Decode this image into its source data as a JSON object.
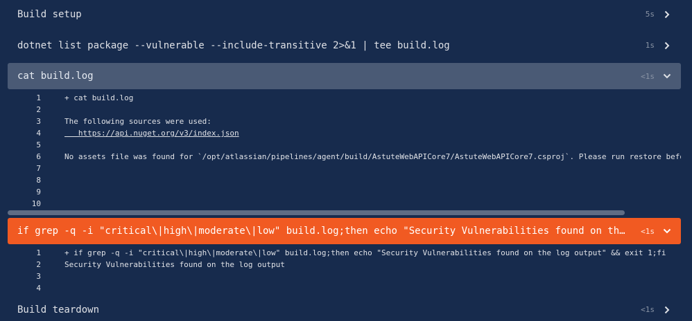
{
  "steps": [
    {
      "title": "Build setup",
      "duration": "5s",
      "chevron": "chevron-right-icon"
    },
    {
      "title": "dotnet list package --vulnerable --include-transitive 2>&1 | tee build.log",
      "duration": "1s",
      "chevron": "chevron-right-icon"
    },
    {
      "title": "cat build.log",
      "duration": "<1s",
      "chevron": "chevron-down-icon"
    },
    {
      "title": "if grep -q -i \"critical\\|high\\|moderate\\|low\" build.log;then echo \"Security Vulnerabilities found on the log output\"…",
      "duration": "<1s",
      "chevron": "chevron-down-icon"
    },
    {
      "title": "Build teardown",
      "duration": "<1s",
      "chevron": "chevron-right-icon"
    }
  ],
  "log_cat": [
    {
      "n": "1",
      "text": "+ cat build.log"
    },
    {
      "n": "2",
      "text": ""
    },
    {
      "n": "3",
      "text": "The following sources were used:"
    },
    {
      "n": "4",
      "text": "   https://api.nuget.org/v3/index.json"
    },
    {
      "n": "5",
      "text": ""
    },
    {
      "n": "6",
      "text": "No assets file was found for `/opt/atlassian/pipelines/agent/build/AstuteWebAPICore7/AstuteWebAPICore7.csproj`. Please run restore before running"
    },
    {
      "n": "7",
      "text": ""
    },
    {
      "n": "8",
      "text": ""
    },
    {
      "n": "9",
      "text": ""
    },
    {
      "n": "10",
      "text": ""
    }
  ],
  "log_grep": [
    {
      "n": "1",
      "text": "+ if grep -q -i \"critical\\|high\\|moderate\\|low\" build.log;then echo \"Security Vulnerabilities found on the log output\" && exit 1;fi"
    },
    {
      "n": "2",
      "text": "Security Vulnerabilities found on the log output"
    },
    {
      "n": "3",
      "text": ""
    },
    {
      "n": "4",
      "text": ""
    }
  ],
  "colors": {
    "background": "#172b4d",
    "active_step": "#4a5a75",
    "failed_step": "#f15a22",
    "scrollbar": "#5e6c84"
  }
}
